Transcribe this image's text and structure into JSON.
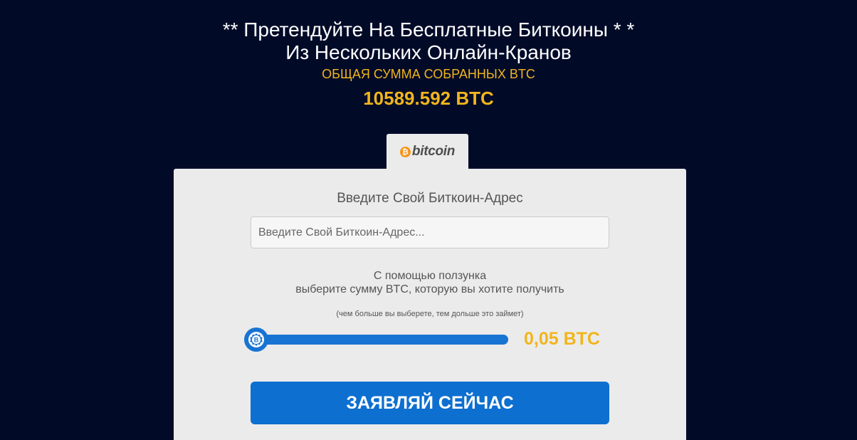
{
  "header": {
    "title_line1": "** Претендуйте На Бесплатные Биткоины * *",
    "title_line2": "Из Нескольких Онлайн-Кранов",
    "subtitle": "ОБЩАЯ СУММА СОБРАННЫХ BTC",
    "total": "10589.592 BTC"
  },
  "tab": {
    "icon": "bitcoin-coin-icon",
    "label": "bitcoin",
    "coin_symbol": "₿"
  },
  "form": {
    "address_label": "Введите Свой Биткоин-Адрес",
    "address_value": "",
    "address_placeholder": "Введите Свой Биткоин-Адрес...",
    "slider_text_line1": "С помощью ползунка",
    "slider_text_line2": "выберите сумму BTC, которую вы хотите получить",
    "slider_note": "(чем больше вы выберете, тем дольше это займет)",
    "slider_value": "0,05 BTC",
    "slider_fraction": 0,
    "claim_button": "ЗАЯВЛЯЙ СЕЙЧАС"
  },
  "colors": {
    "background": "#010b28",
    "accent_gold": "#f1b51d",
    "primary_blue": "#0d6fd0",
    "panel": "#ebebeb",
    "bitcoin_orange": "#f7931a"
  }
}
